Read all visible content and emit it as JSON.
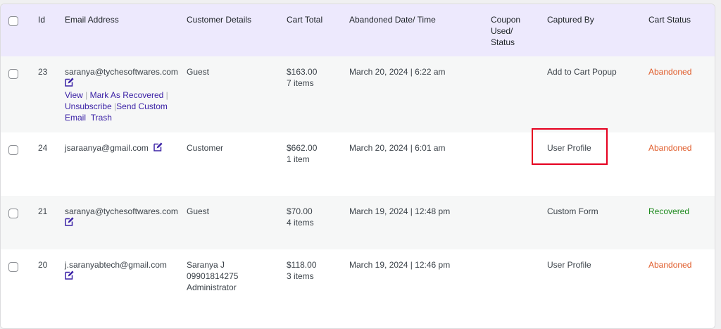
{
  "columns": {
    "id": "Id",
    "email": "Email Address",
    "customer": "Customer Details",
    "total": "Cart Total",
    "date": "Abandoned Date/ Time",
    "coupon_1": "Coupon",
    "coupon_2": "Used/",
    "coupon_3": "Status",
    "captured": "Captured By",
    "status": "Cart Status"
  },
  "row_actions": {
    "view": "View",
    "mark_recovered": "Mark As Recovered",
    "unsubscribe": "Unsubscribe",
    "send_custom_1": "Send Custom",
    "send_custom_2": "Email",
    "trash": "Trash"
  },
  "rows": [
    {
      "id": "23",
      "email": "saranya@tychesoftwares.com",
      "customer_1": "Guest",
      "total": "$163.00",
      "items": "7 items",
      "date": "March 20, 2024 | 6:22 am",
      "captured": "Add to Cart Popup",
      "status": "Abandoned"
    },
    {
      "id": "24",
      "email": "jsaraanya@gmail.com",
      "customer_1": "Customer",
      "total": "$662.00",
      "items": "1 item",
      "date": "March 20, 2024 | 6:01 am",
      "captured": "User Profile",
      "status": "Abandoned"
    },
    {
      "id": "21",
      "email": "saranya@tychesoftwares.com",
      "customer_1": "Guest",
      "total": "$70.00",
      "items": "4 items",
      "date": "March 19, 2024 | 12:48 pm",
      "captured": "Custom Form",
      "status": "Recovered"
    },
    {
      "id": "20",
      "email": "j.saranyabtech@gmail.com",
      "customer_1": "Saranya J",
      "customer_2": "09901814275",
      "customer_3": "Administrator",
      "total": "$118.00",
      "items": "3 items",
      "date": "March 19, 2024 | 12:46 pm",
      "captured": "User Profile",
      "status": "Abandoned"
    }
  ],
  "colors": {
    "header_bg": "#ede9fd",
    "link": "#3b22a6",
    "abandoned": "#e05d2c",
    "recovered": "#1e8a1e",
    "highlight": "#e5001f"
  },
  "icons": {
    "edit": "edit-pencil-icon"
  }
}
